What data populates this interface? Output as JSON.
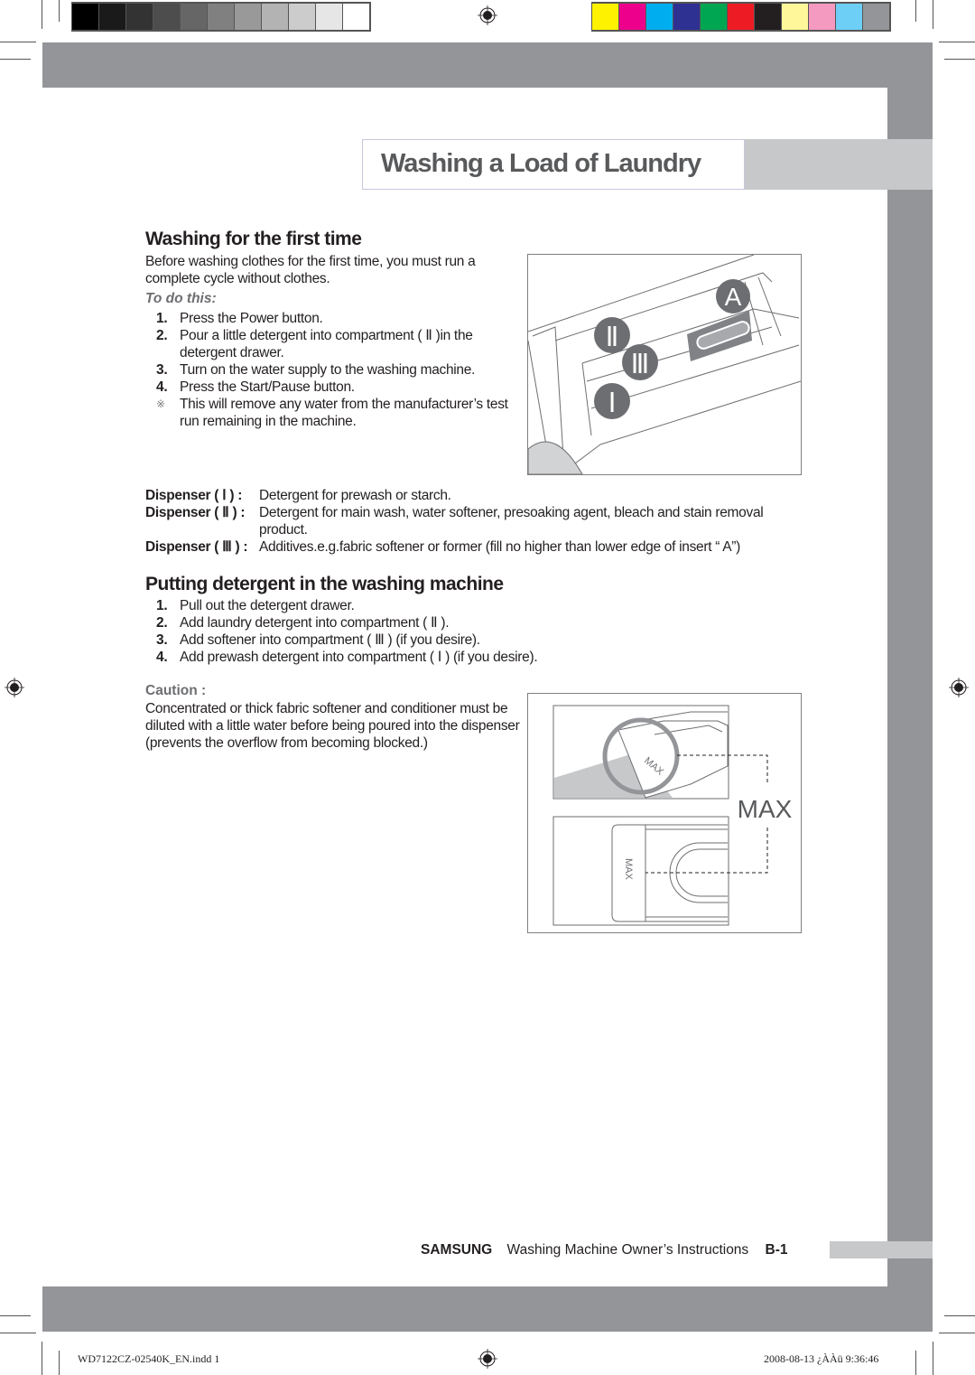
{
  "print_marks": {
    "grayscale_swatches": [
      "#000000",
      "#1a1a1a",
      "#333333",
      "#4d4d4d",
      "#666666",
      "#808080",
      "#999999",
      "#b3b3b3",
      "#cccccc",
      "#e6e6e6",
      "#ffffff"
    ],
    "color_swatches": [
      "#fff200",
      "#ec008c",
      "#00aeef",
      "#2e3192",
      "#00a651",
      "#ed1c24",
      "#231f20",
      "#fff799",
      "#f49ac1",
      "#6dcff6",
      "#939598"
    ]
  },
  "colors": {
    "frame_gray": "#939598",
    "light_gray": "#c7c8ca",
    "title_text": "#58595b",
    "body_text": "#231f20",
    "muted_text": "#6d6e71"
  },
  "header": {
    "title": "Washing a Load of Laundry"
  },
  "section1": {
    "heading": "Washing for the first time",
    "intro": "Before washing clothes for the first time, you must run a complete cycle without clothes.",
    "subheading": "To do this:",
    "steps": [
      {
        "num": "1.",
        "text": "Press the Power button."
      },
      {
        "num": "2.",
        "text": "Pour a little detergent into compartment ( Ⅱ )in the detergent drawer."
      },
      {
        "num": "3.",
        "text": "Turn on the water supply to the washing machine."
      },
      {
        "num": "4.",
        "text": "Press the Start/Pause button."
      },
      {
        "num": "※",
        "text": "This will remove any water from the manufacturer’s test run remaining in the machine."
      }
    ],
    "figure": {
      "labels": [
        "A",
        "Ⅱ",
        "Ⅲ",
        "Ⅰ"
      ]
    }
  },
  "dispensers": [
    {
      "label": "Dispenser ( Ⅰ ) :",
      "text": "Detergent for prewash or starch."
    },
    {
      "label": "Dispenser ( Ⅱ ) :",
      "text": "Detergent for main wash, water softener, presoaking agent, bleach and stain removal product."
    },
    {
      "label": "Dispenser ( Ⅲ ) :",
      "text": "Additives.e.g.fabric softener or former (fill no higher than lower edge of insert “ A”)"
    }
  ],
  "section2": {
    "heading": "Putting detergent in the washing machine",
    "steps": [
      {
        "num": "1.",
        "text": "Pull out the detergent drawer."
      },
      {
        "num": "2.",
        "text": "Add laundry detergent into compartment ( Ⅱ )."
      },
      {
        "num": "3.",
        "text": "Add softener into compartment ( Ⅲ ) (if you desire)."
      },
      {
        "num": "4.",
        "text": "Add prewash detergent into compartment ( Ⅰ ) (if you desire)."
      }
    ],
    "caution_label": "Caution :",
    "caution_text": "Concentrated or thick fabric softener and conditioner must be diluted with a little water before being poured into the dispenser (prevents the overflow from becoming blocked.)",
    "figure": {
      "max_label": "MAX",
      "small_max_label": "MAX"
    }
  },
  "footer": {
    "brand": "SAMSUNG",
    "doc_title": "Washing Machine Owner’s Instructions",
    "page": "B-1"
  },
  "slug": {
    "filename": "WD7122CZ-02540K_EN.indd   1",
    "datetime": "2008-08-13   ¿ÀÀü 9:36:46"
  }
}
